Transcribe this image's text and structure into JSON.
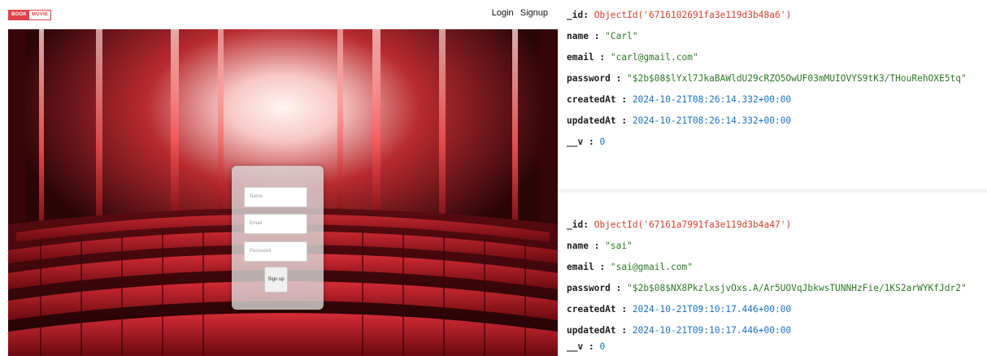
{
  "app": {
    "logo": {
      "part1": "BOOK",
      "part2": "MOVIE"
    },
    "nav": {
      "login": "Login",
      "signup": "Signup"
    },
    "form": {
      "name_placeholder": "Name",
      "email_placeholder": "Email",
      "password_placeholder": "Password",
      "submit_label": "Sign up"
    }
  },
  "db": {
    "documents": [
      {
        "id_key": "_id",
        "id_value": "ObjectId('6716102691fa3e119d3b48a6')",
        "name_key": "name",
        "name_value": "\"Carl\"",
        "email_key": "email",
        "email_value": "\"carl@gmail.com\"",
        "password_key": "password",
        "password_value": "\"$2b$08$lYxl7JkaBAWldU29cRZO5OwUF03mMUIOVYS9tK3/THouRehOXE5tq\"",
        "created_key": "createdAt",
        "created_value": "2024-10-21T08:26:14.332+00:00",
        "updated_key": "updatedAt",
        "updated_value": "2024-10-21T08:26:14.332+00:00",
        "v_key": "__v",
        "v_value": "0"
      },
      {
        "id_key": "_id",
        "id_value": "ObjectId('67161a7991fa3e119d3b4a47')",
        "name_key": "name",
        "name_value": "\"sai\"",
        "email_key": "email",
        "email_value": "\"sai@gmail.com\"",
        "password_key": "password",
        "password_value": "\"$2b$08$NX8PkzlxsjvOxs.A/Ar5UOVqJbkwsTUNNHzFie/1KS2arWYKfJdr2\"",
        "created_key": "createdAt",
        "created_value": "2024-10-21T09:10:17.446+00:00",
        "updated_key": "updatedAt",
        "updated_value": "2024-10-21T09:10:17.446+00:00",
        "v_key": "__v",
        "v_value": "0"
      }
    ]
  },
  "colors": {
    "brand": "#e0414b",
    "objectid": "#d8412f",
    "string": "#2c7a24",
    "date": "#1b73c8"
  }
}
